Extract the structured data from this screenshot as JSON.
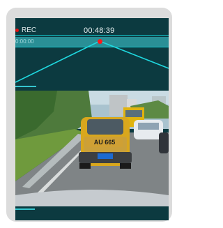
{
  "recording": {
    "label": "REC"
  },
  "timecode": {
    "current": "00:48:39"
  },
  "timeline": {
    "start_time": "0:00:00"
  },
  "video": {
    "plate_text": "AU 665"
  },
  "colors": {
    "panel_bg": "#0c3a40",
    "accent_cyan": "#12c8ce",
    "rec_red": "#e10f0f",
    "playhead_red": "#ff1a1a"
  }
}
